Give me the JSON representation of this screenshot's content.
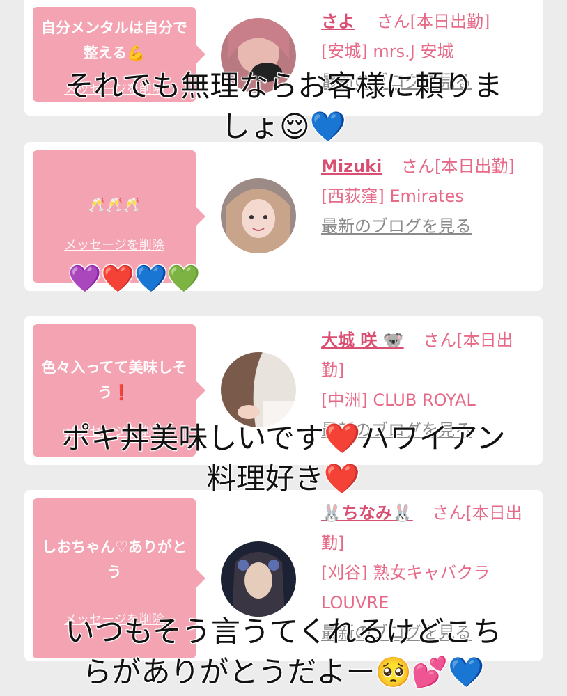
{
  "cards": [
    {
      "message": "自分メンタルは自分で整える💪",
      "delete_label": "メッセージを削除",
      "name": "さよ",
      "san": "さん[本日出勤]",
      "store": "[安城] mrs.J 安城",
      "blog_label": "最新のブログを見る"
    },
    {
      "message": "🥂🥂🥂",
      "delete_label": "メッセージを削除",
      "name": "Mizuki",
      "san": "さん[本日出勤]",
      "store": "[西荻窪] Emirates",
      "blog_label": "最新のブログを見る"
    },
    {
      "message": "色々入ってて美味しそう❗️",
      "delete_label": "メッセージを削除",
      "name": "大城 咲 🐨",
      "san": "さん[本日出勤]",
      "store": "[中洲] CLUB ROYAL",
      "blog_label": "最新のブログを見る"
    },
    {
      "message": "しおちゃん♡ありがとう",
      "delete_label": "メッセージを削除",
      "name": "🐰ちなみ🐰",
      "san": "さん[本日出勤]",
      "store": "[刈谷] 熟女キャバクラ LOUVRE",
      "blog_label": "最新のブログを見る"
    }
  ],
  "overlays": {
    "caption1_line1": "それでも無理ならお客様に頼りま",
    "caption1_line2": "しょ😌💙",
    "hearts": "💜❤️💙💚",
    "caption2_line1": "ポキ丼美味しいです❤️ハワイアン",
    "caption2_line2": "料理好き❤️",
    "caption3_line1": "いつもそう言うてくれるけどこち",
    "caption3_line2": "らがありがとうだよー🥺💕💙"
  },
  "colors": {
    "bubble": "#f4a3b2",
    "accent": "#e66a87",
    "background": "#ececec"
  }
}
